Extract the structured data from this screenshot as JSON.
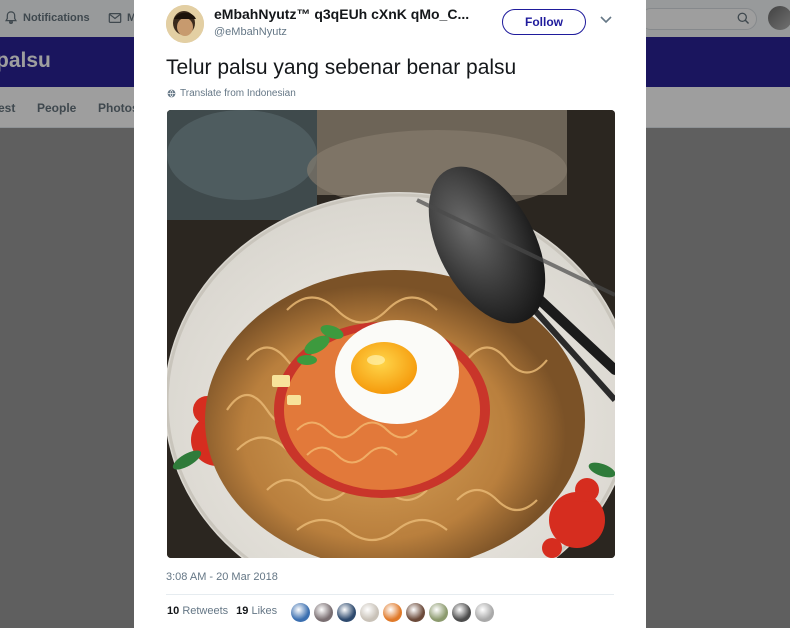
{
  "topnav": {
    "notifications_label": "Notifications",
    "messages_label": "M"
  },
  "profile_banner": {
    "title": "palsu"
  },
  "subnav": {
    "tabs": [
      "est",
      "People",
      "Photos"
    ]
  },
  "tweet": {
    "display_name": "eMbahNyutz™ q3qEUh cXnK qMo_C...",
    "handle": "@eMbahNyutz",
    "follow_label": "Follow",
    "text": "Telur palsu yang sebenar benar palsu",
    "translate_label": "Translate from Indonesian",
    "timestamp": "3:08 AM - 20 Mar 2018",
    "retweets_count": "10",
    "retweets_label": "Retweets",
    "likes_count": "19",
    "likes_label": "Likes",
    "liker_colors": [
      "#3b6fb0",
      "#7a6f72",
      "#2e4a6e",
      "#c9c2b8",
      "#e07a2a",
      "#6b4a3a",
      "#8c9a6e",
      "#4d4d4d",
      "#a9a9a9"
    ]
  },
  "colors": {
    "brand": "#2a2398",
    "follow": "#1f1b9c"
  }
}
